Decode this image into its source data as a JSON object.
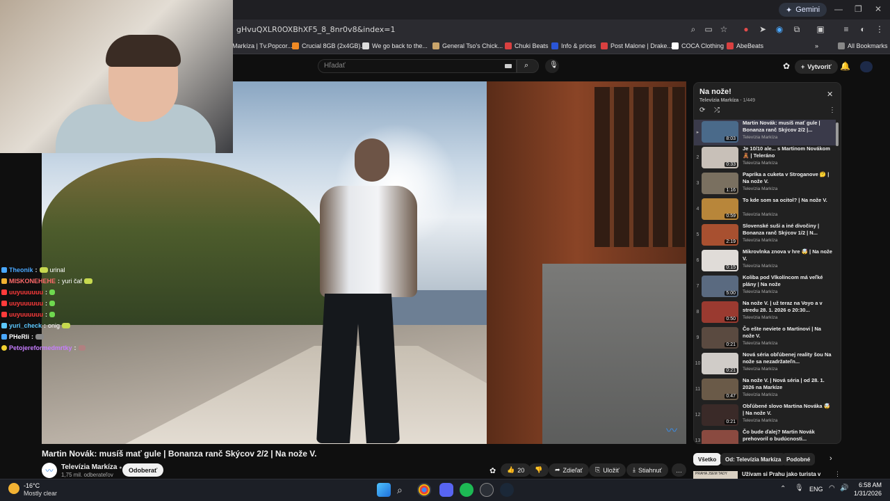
{
  "browser": {
    "gemini_label": "Gemini",
    "url": "gHvuQXLR0OXBhXF5_8_8nr0v8&index=1",
    "bookmarks": [
      {
        "label": "Markíza | Tv.Popcor...",
        "color": "#e34b4b"
      },
      {
        "label": "Crucial 8GB (2x4GB)...",
        "color": "#f08a24"
      },
      {
        "label": "We go back to the...",
        "color": "#dddddd"
      },
      {
        "label": "General Tso's Chick...",
        "color": "#c9a46b"
      },
      {
        "label": "Chuki Beats",
        "color": "#d94040"
      },
      {
        "label": "Info & prices",
        "color": "#2a55d6"
      },
      {
        "label": "Post Malone | Drake...",
        "color": "#d94040"
      },
      {
        "label": "COCA Clothing",
        "color": "#ffffff"
      },
      {
        "label": "AbeBeats",
        "color": "#d94040"
      }
    ],
    "more_bookmarks": "»",
    "all_bookmarks": "All Bookmarks"
  },
  "youtube": {
    "search_placeholder": "Hľadať",
    "create_label": "Vytvoriť",
    "video_title": "Martin Novák: musíš mať gule | Bonanza ranč Skýcov 2/2 | Na nože V.",
    "channel_name": "Televízia Markíza",
    "channel_verified": "●",
    "channel_subs": "1,75 mil. odberateľov",
    "subscribe_label": "Odoberať",
    "like_count": "20",
    "share_label": "Zdieľať",
    "save_label": "Uložiť",
    "download_label": "Stiahnuť",
    "more_label": "…"
  },
  "chat": [
    {
      "user": "Theonik",
      "color": "#4aa8ff",
      "msg": "urinal"
    },
    {
      "user": "MISKONEHEHE",
      "color": "#ff6a6a",
      "msg": "yuri čaf"
    },
    {
      "user": "uuyuuuuuu",
      "color": "#ff3b3b",
      "msg": ""
    },
    {
      "user": "uuyuuuuuu",
      "color": "#ff3b3b",
      "msg": ""
    },
    {
      "user": "uuyuuuuuu",
      "color": "#ff3b3b",
      "msg": ""
    },
    {
      "user": "yuri_check",
      "color": "#5cc8ff",
      "msg": "onig"
    },
    {
      "user": "PHeRIi",
      "color": "#ffffff",
      "msg": ""
    },
    {
      "user": "Petojereformedmrtky",
      "color": "#c77dff",
      "msg": ""
    }
  ],
  "playlist": {
    "title": "Na nože!",
    "channel": "Televízia Markíza",
    "position": "1/449",
    "items": [
      {
        "idx": "▸",
        "title": "Martin Novák: musíš mať gule | Bonanza ranč Skýcov 2/2 |...",
        "channel": "Televízia Markíza",
        "duration": "8:03",
        "color": "#4a6a8a"
      },
      {
        "idx": "2",
        "title": "Je 10/10 ale... s Martinom Novákom 🧸 | Teleráno",
        "channel": "Televízia Markíza",
        "duration": "0:33",
        "color": "#c8c0b8"
      },
      {
        "idx": "3",
        "title": "Paprika a cuketa v Stroganove 🤔 | Na nože V.",
        "channel": "Televízia Markíza",
        "duration": "1:16",
        "color": "#7a7060"
      },
      {
        "idx": "4",
        "title": "To kde som sa ocitol? | Na nože V.",
        "channel": "Televízia Markíza",
        "duration": "0:59",
        "color": "#b8863a"
      },
      {
        "idx": "5",
        "title": "Slovenské suši a iné divočiny | Bonanza ranč Skýcov 1/2 | N...",
        "channel": "Televízia Markíza",
        "duration": "2:19",
        "color": "#a85030"
      },
      {
        "idx": "6",
        "title": "Mikrovlnka znova v hre 🤯 | Na nože V.",
        "channel": "Televízia Markíza",
        "duration": "0:15",
        "color": "#e0dcd8"
      },
      {
        "idx": "7",
        "title": "Koliba pod Vlkolíncom má veľké plány | Na nože",
        "channel": "Televízia Markíza",
        "duration": "5:00",
        "color": "#5a6a80"
      },
      {
        "idx": "8",
        "title": "Na nože V. | už teraz na Voyo a v stredu 28. 1. 2026 o 20:30...",
        "channel": "Televízia Markíza",
        "duration": "0:50",
        "color": "#9a3a30"
      },
      {
        "idx": "9",
        "title": "Čo ešte neviete o Martinovi | Na nože V.",
        "channel": "Televízia Markíza",
        "duration": "0:21",
        "color": "#5a4a40"
      },
      {
        "idx": "10",
        "title": "Nová séria obľúbenej reality šou Na nože sa nezadržateľn...",
        "channel": "Televízia Markíza",
        "duration": "0:21",
        "color": "#d0ccc8"
      },
      {
        "idx": "11",
        "title": "Na nože V. | Nová séria | od 28. 1. 2026 na Markíze",
        "channel": "Televízia Markíza",
        "duration": "0:47",
        "color": "#6a5a48"
      },
      {
        "idx": "12",
        "title": "Obľúbené slovo Martina Nováka 🤯 | Na nože V.",
        "channel": "Televízia Markíza",
        "duration": "0:21",
        "color": "#3a2a28"
      },
      {
        "idx": "13",
        "title": "Čo bude ďalej? Martin Novák prehovoril o budúcnosti...",
        "channel": "Televízia Markíza",
        "duration": "",
        "color": "#8a4a40"
      }
    ]
  },
  "chips": [
    "Všetko",
    "Od: Televízia Markíza",
    "Podobné"
  ],
  "next_row": {
    "title": "Užívam si Prahu jako turista v",
    "thumb_text": "PRAHA JSEM TADY"
  },
  "taskbar": {
    "weather_temp": "-16°C",
    "weather_desc": "Mostly clear",
    "lang": "ENG",
    "time": "6:58 AM",
    "date": "1/31/2026"
  }
}
